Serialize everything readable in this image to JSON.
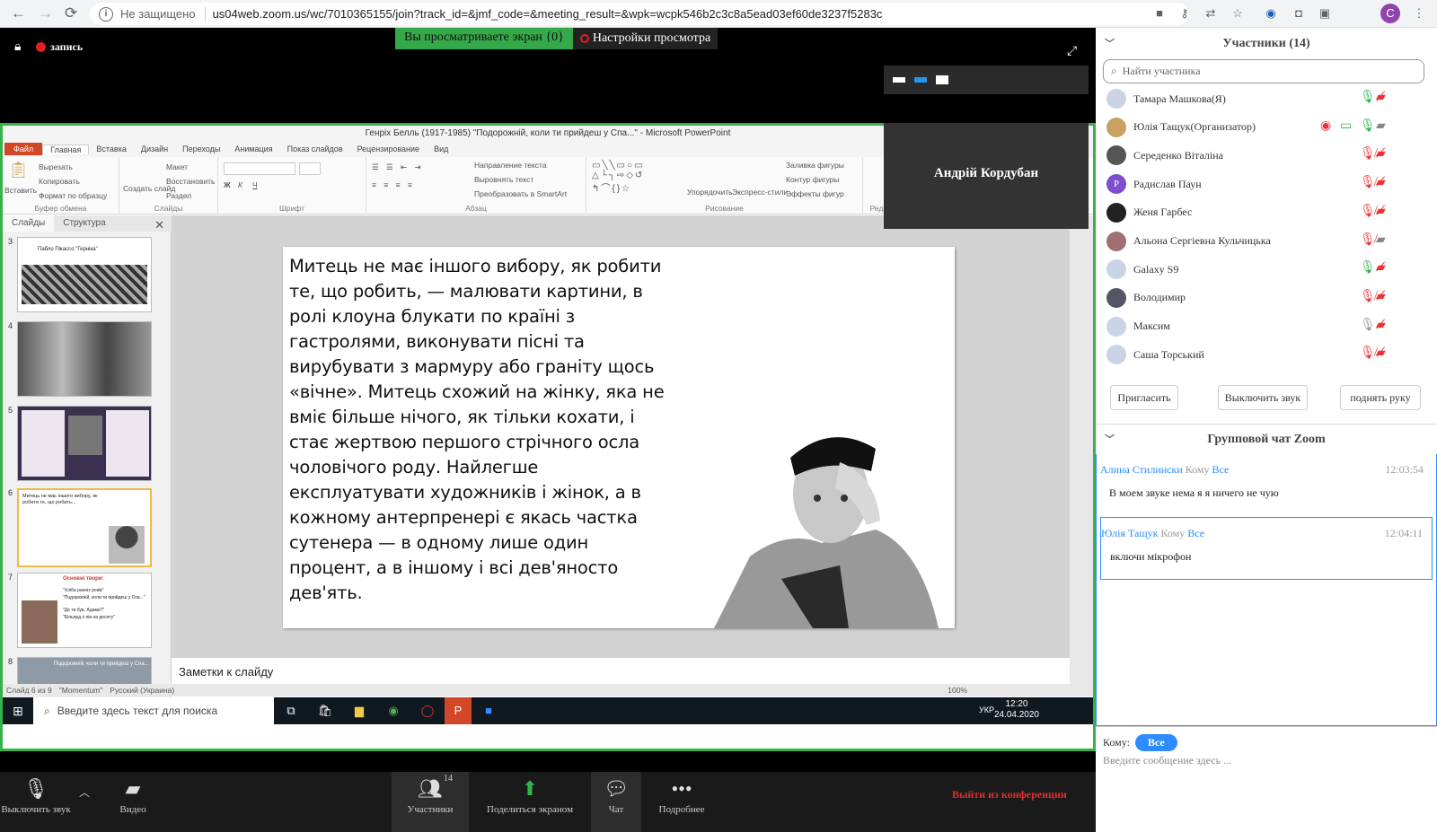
{
  "browser": {
    "not_secure": "Не защищено",
    "url": "us04web.zoom.us/wc/7010365155/join?track_id=&jmf_code=&meeting_result=&wpk=wcpk546b2c3c8a5ead03ef60de3237f5283c",
    "avatar": "C"
  },
  "meeting": {
    "recording": "запись",
    "viewing_label": "Вы просматриваете экран {0}",
    "view_settings": "Настройки просмотра",
    "video_name": "Андрій Кордубан"
  },
  "powerpoint": {
    "title": "Генріх Белль (1917-1985) \"Подорожній, коли ти прийдеш у Спа...\" - Microsoft PowerPoint",
    "menu": [
      "Файл",
      "Главная",
      "Вставка",
      "Дизайн",
      "Переходы",
      "Анимация",
      "Показ слайдов",
      "Рецензирование",
      "Вид"
    ],
    "ribbon": {
      "clipboard": {
        "paste": "Вставить",
        "cut": "Вырезать",
        "copy": "Копировать",
        "format": "Формат по образцу",
        "caption": "Буфер обмена"
      },
      "slides": {
        "create": "Создать слайд",
        "layout": "Макет",
        "restore": "Восстановить",
        "section": "Раздел",
        "caption": "Слайды"
      },
      "font_caption": "Шрифт",
      "paragraph": {
        "direction": "Направление текста",
        "align": "Выровнять текст",
        "smartart": "Преобразовать в SmartArt",
        "caption": "Абзац"
      },
      "drawing": {
        "arrange": "Упорядочить",
        "styles": "Экспресс-стили",
        "fill": "Заливка фигуры",
        "outline": "Контур фигуры",
        "effects": "Эффекты фигур",
        "caption": "Рисование"
      },
      "editing": {
        "find": "Найти",
        "replace": "Заменить",
        "select": "Выделить",
        "caption": "Редактирование"
      }
    },
    "panel_tabs": [
      "Слайды",
      "Структура"
    ],
    "thumbs": [
      {
        "num": "3",
        "title": "Пабло Пікассо \"Герніка\""
      },
      {
        "num": "4",
        "title": ""
      },
      {
        "num": "5",
        "title": ""
      },
      {
        "num": "6",
        "title": "Митець не має іншого вибору, як робити те, що робить..."
      },
      {
        "num": "7",
        "title": "Основні твори:",
        "lines": [
          "\"Хліба ранніх років\"",
          "\"Подорожній, коли ти прийдеш у Спа...\"",
          "\"Де ти був, Адаме?\"",
          "\"Більярд о пів на десяту\""
        ]
      },
      {
        "num": "8",
        "title": "Подорожній, коли ти прийдеш у Спа..."
      }
    ],
    "slide_text": "Митець не має іншого вибору, як робити те, що робить, — малювати картини, в ролі клоуна блукати по країні з гастролями, виконувати пісні та вирубувати з мармуру або граніту щось «вічне». Митець схожий на жінку, яка не вміє більше нічого, як тільки кохати, і стає жертвою першого стрічного осла чоловічого роду. Найлегше експлуатувати художників і жінок, а в кожному антерпренері є якась частка сутенера — в одному лише один процент, а в іншому і всі дев'яносто дев'ять.",
    "notes": "Заметки к слайду",
    "status": [
      "Слайд 6 из 9",
      "\"Momentum\"",
      "Русский (Украина)"
    ],
    "zoom": "100%"
  },
  "taskbar": {
    "search": "Введите здесь текст для поиска",
    "lang": "УКР",
    "time": "12:20",
    "date": "24.04.2020"
  },
  "toolbar": {
    "mute": "Выключить звук",
    "video": "Видео",
    "participants": "Участники",
    "participants_count": "14",
    "share": "Поделиться экраном",
    "chat": "Чат",
    "more": "Подробнее",
    "leave": "Выйти из конференции"
  },
  "participants": {
    "title": "Участники (14)",
    "search_placeholder": "Найти участника",
    "list": [
      {
        "name": "Тамара Машкова(Я)",
        "initial": "",
        "mic": "on",
        "video": "off"
      },
      {
        "name": "Юлія Тащук(Организатор)",
        "initial": "",
        "mic": "on",
        "video": "on"
      },
      {
        "name": "Середенко Віталіна",
        "initial": "",
        "mic": "off",
        "video": "off"
      },
      {
        "name": "Радислав Паун",
        "initial": "Р",
        "mic": "off",
        "video": "off"
      },
      {
        "name": "Женя Гарбес",
        "initial": "",
        "mic": "off",
        "video": "off"
      },
      {
        "name": "Альона Сергіевна Кульчицька",
        "initial": "",
        "mic": "off",
        "video": "on"
      },
      {
        "name": "Galaxy S9",
        "initial": "",
        "mic": "on",
        "video": "off"
      },
      {
        "name": "Володимир",
        "initial": "",
        "mic": "off",
        "video": "off"
      },
      {
        "name": "Максим",
        "initial": "",
        "mic": "muted",
        "video": "off"
      },
      {
        "name": "Саша Торський",
        "initial": "",
        "mic": "off",
        "video": "off"
      }
    ],
    "invite": "Пригласить",
    "mute_all": "Выключить звук",
    "raise_hand": "поднять руку"
  },
  "chat": {
    "title": "Групповой чат Zoom",
    "to_word": "Кому",
    "messages": [
      {
        "from": "Алина Стилински",
        "to": "Все",
        "time": "12:03:54",
        "text": "В моем звуке нема я я ничего не чую"
      },
      {
        "from": "Юлія Тащук",
        "to": "Все",
        "time": "12:04:11",
        "text": "включи мікрофон"
      }
    ],
    "to_label": "Кому:",
    "to_value": "Все",
    "placeholder": "Введите сообщение здесь ..."
  },
  "colors": {
    "accent": "#2d8cff",
    "share_border": "#35b34a",
    "leave": "#e03030",
    "ppt": "#d24726"
  }
}
